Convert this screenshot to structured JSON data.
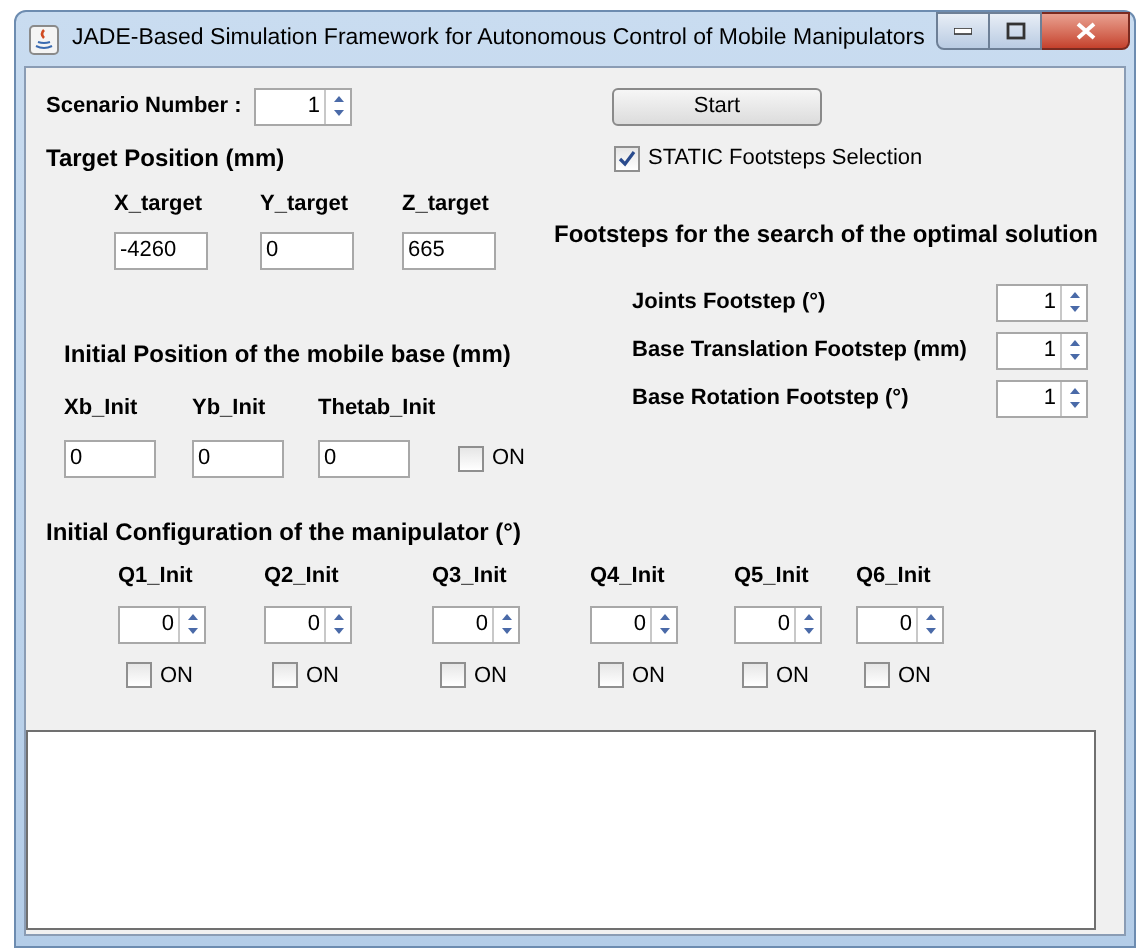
{
  "window": {
    "title": "JADE-Based Simulation Framework for Autonomous Control of Mobile Manipulators"
  },
  "scenario": {
    "label": "Scenario Number :",
    "value": "1"
  },
  "start_button": "Start",
  "static_checkbox": {
    "label": "STATIC Footsteps Selection",
    "checked": true
  },
  "target": {
    "heading": "Target Position (mm)",
    "fields": [
      {
        "label": "X_target",
        "value": "-4260"
      },
      {
        "label": "Y_target",
        "value": "0"
      },
      {
        "label": "Z_target",
        "value": "665"
      }
    ]
  },
  "footsteps": {
    "heading": "Footsteps for the search of the optimal solution",
    "items": [
      {
        "label": "Joints Footstep (°)",
        "value": "1"
      },
      {
        "label": "Base Translation Footstep (mm)",
        "value": "1"
      },
      {
        "label": "Base Rotation Footstep (°)",
        "value": "1"
      }
    ]
  },
  "base": {
    "heading": "Initial Position of the mobile base (mm)",
    "fields": [
      {
        "label": "Xb_Init",
        "value": "0"
      },
      {
        "label": "Yb_Init",
        "value": "0"
      },
      {
        "label": "Thetab_Init",
        "value": "0"
      }
    ],
    "checkbox": {
      "label": "ON",
      "checked": false
    }
  },
  "manipulator": {
    "heading": "Initial Configuration of the manipulator (°)",
    "joints": [
      {
        "label": "Q1_Init",
        "value": "0",
        "checkbox_label": "ON",
        "checked": false
      },
      {
        "label": "Q2_Init",
        "value": "0",
        "checkbox_label": "ON",
        "checked": false
      },
      {
        "label": "Q3_Init",
        "value": "0",
        "checkbox_label": "ON",
        "checked": false
      },
      {
        "label": "Q4_Init",
        "value": "0",
        "checkbox_label": "ON",
        "checked": false
      },
      {
        "label": "Q5_Init",
        "value": "0",
        "checkbox_label": "ON",
        "checked": false
      },
      {
        "label": "Q6_Init",
        "value": "0",
        "checkbox_label": "ON",
        "checked": false
      }
    ]
  }
}
